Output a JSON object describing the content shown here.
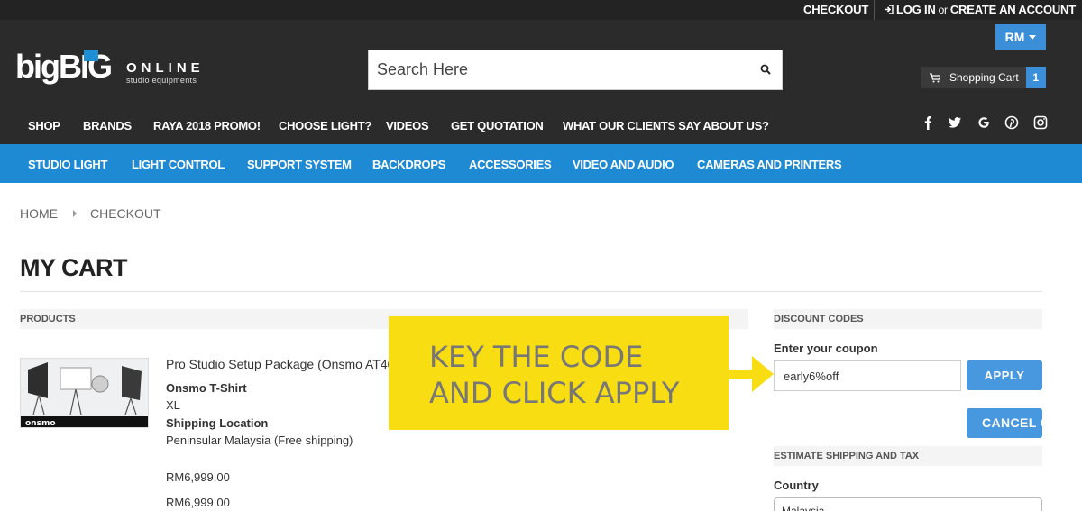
{
  "topbar": {
    "checkout": "CHECKOUT",
    "login": "LOG IN",
    "or": "or",
    "create_account": "CREATE AN ACCOUNT"
  },
  "header": {
    "logo": {
      "big": "bigBIG",
      "online": "ONLINE",
      "tagline": "studio equipments"
    },
    "search_placeholder": "Search Here",
    "currency": "RM",
    "cart_label": "Shopping Cart",
    "cart_count": "1"
  },
  "main_nav": [
    "SHOP",
    "BRANDS",
    "RAYA 2018 PROMO!",
    "CHOOSE LIGHT?",
    "VIDEOS",
    "GET QUOTATION",
    "WHAT OUR CLIENTS SAY ABOUT US?"
  ],
  "social_icons": [
    "facebook-icon",
    "twitter-icon",
    "google-icon",
    "pinterest-icon",
    "instagram-icon"
  ],
  "category_nav": [
    "STUDIO LIGHT",
    "LIGHT CONTROL",
    "SUPPORT SYSTEM",
    "BACKDROPS",
    "ACCESSORIES",
    "VIDEO AND AUDIO",
    "CAMERAS AND PRINTERS"
  ],
  "breadcrumb": {
    "home": "HOME",
    "current": "CHECKOUT"
  },
  "page_title": "MY CART",
  "products": {
    "heading": "PRODUCTS",
    "item": {
      "name": "Pro Studio Setup Package (Onsmo AT40",
      "option1_label": "Onsmo T-Shirt",
      "option1_value": "XL",
      "option2_label": "Shipping Location",
      "option2_value": "Peninsular Malaysia (Free shipping)",
      "price": "RM6,999.00",
      "subtotal": "RM6,999.00",
      "brand_mark": "onsmo"
    }
  },
  "callout": {
    "line1": "KEY THE CODE",
    "line2": "AND CLICK APPLY"
  },
  "discount": {
    "heading": "DISCOUNT CODES",
    "label": "Enter your coupon",
    "coupon_value": "early6%off",
    "apply": "APPLY",
    "cancel": "CANCEL C"
  },
  "shipping": {
    "heading": "ESTIMATE SHIPPING AND TAX",
    "country_label": "Country",
    "country_value": "Malaysia"
  },
  "colors": {
    "dark_header": "#2b2b2b",
    "accent_blue": "#1f8ad4",
    "callout_yellow": "#f8dd12"
  }
}
